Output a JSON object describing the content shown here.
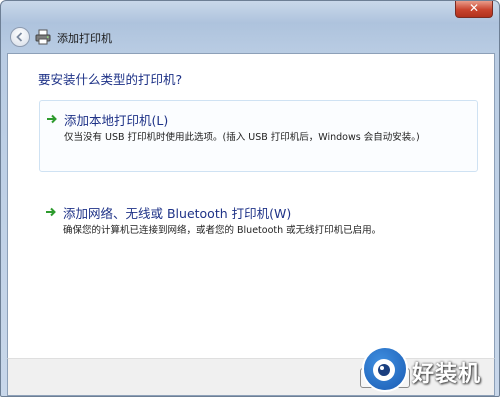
{
  "window": {
    "close_glyph": "✕"
  },
  "nav": {
    "title": "添加打印机"
  },
  "main": {
    "heading": "要安装什么类型的打印机?",
    "options": [
      {
        "title": "添加本地打印机(L)",
        "description": "仅当没有 USB 打印机时使用此选项。(插入 USB 打印机后，Windows 会自动安装。)"
      },
      {
        "title": "添加网络、无线或 Bluetooth 打印机(W)",
        "description": "确保您的计算机已连接到网络，或者您的 Bluetooth 或无线打印机已启用。"
      }
    ]
  },
  "watermark": {
    "text": "好装机"
  },
  "colors": {
    "link_blue": "#1e3287",
    "arrow_green": "#2e9b2e",
    "close_red": "#c8432d"
  },
  "icons": [
    "close-icon",
    "back-arrow-icon",
    "printer-icon",
    "green-arrow-icon"
  ]
}
